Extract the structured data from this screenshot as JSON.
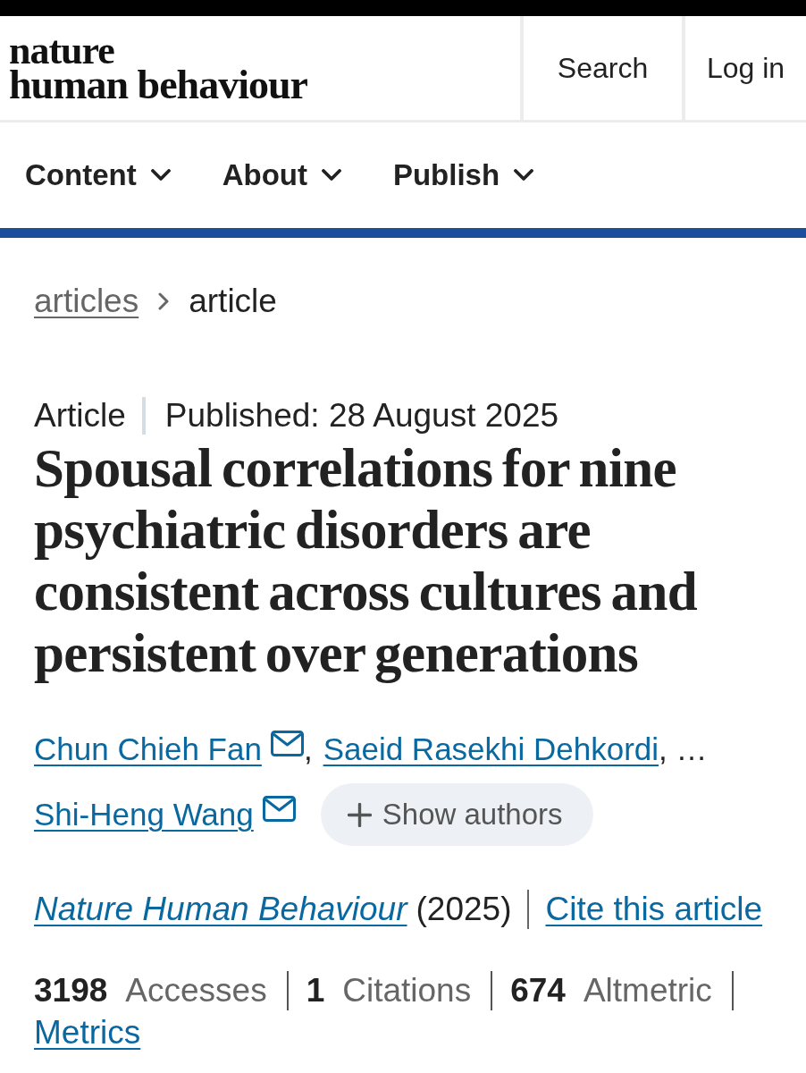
{
  "header": {
    "logo": [
      "nature",
      "human behaviour"
    ],
    "actions": [
      {
        "label": "Search"
      },
      {
        "label": "Log in"
      }
    ]
  },
  "nav": [
    {
      "label": "Content"
    },
    {
      "label": "About"
    },
    {
      "label": "Publish"
    }
  ],
  "breadcrumb": [
    {
      "label": "articles",
      "kind": "link"
    },
    {
      "label": "article",
      "kind": "current"
    }
  ],
  "article": {
    "type": "Article",
    "published": "Published: 28 August 2025",
    "title": "Spousal correlations for nine psychiatric disorders are consistent across cultures and persistent over generations",
    "authors": [
      {
        "name": "Chun Chieh Fan",
        "email": true,
        "suffix": ","
      },
      {
        "name": "Saeid Rasekhi Dehkordi",
        "email": false,
        "suffix": ", …"
      },
      {
        "name": "Shi-Heng Wang",
        "email": true
      }
    ],
    "show_authors": "Show authors",
    "citation": {
      "journal": "Nature Human Behaviour",
      "year": "(2025)",
      "cite": "Cite this article"
    },
    "metrics": [
      {
        "count": "3198",
        "name": "Accesses"
      },
      {
        "count": "1",
        "name": "Citations"
      },
      {
        "count": "674",
        "name": "Altmetric"
      }
    ],
    "metrics_link": "Metrics"
  }
}
